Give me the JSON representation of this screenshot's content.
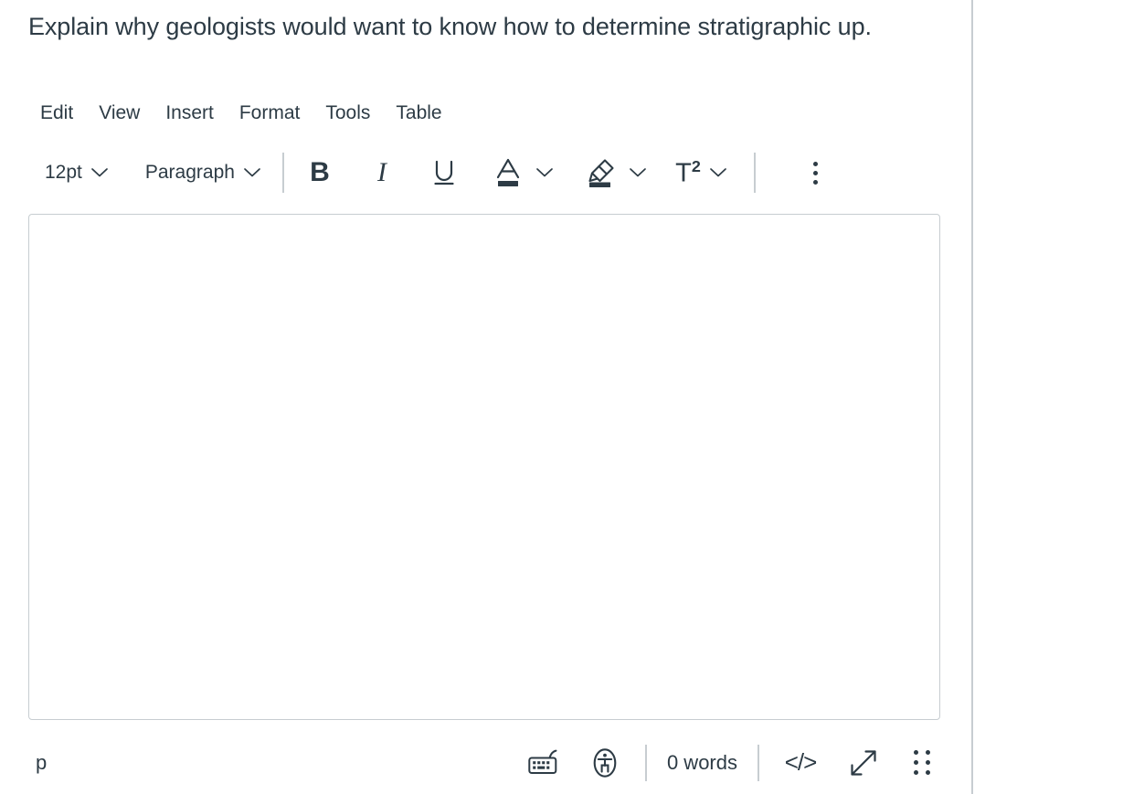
{
  "prompt": {
    "text": "Explain why geologists would want to know how to determine stratigraphic up."
  },
  "menubar": {
    "items": [
      {
        "label": "Edit",
        "name": "menu-edit"
      },
      {
        "label": "View",
        "name": "menu-view"
      },
      {
        "label": "Insert",
        "name": "menu-insert"
      },
      {
        "label": "Format",
        "name": "menu-format"
      },
      {
        "label": "Tools",
        "name": "menu-tools"
      },
      {
        "label": "Table",
        "name": "menu-table"
      }
    ]
  },
  "toolbar": {
    "font_size": "12pt",
    "block_format": "Paragraph",
    "bold_label": "B",
    "italic_label": "I",
    "underline_label": "U",
    "text_color_label": "A",
    "superscript_label": "T",
    "superscript_exponent": "2",
    "more_options_label": "More..."
  },
  "editor": {
    "content": "",
    "placeholder": ""
  },
  "statusbar": {
    "element_path": "p",
    "word_count": "0 words",
    "keyboard_shortcuts_label": "Keyboard shortcuts",
    "accessibility_checker_label": "Accessibility checker",
    "html_editor_label": "</>",
    "fullscreen_label": "Fullscreen",
    "resize_label": "Resize"
  },
  "colors": {
    "text": "#2D3B45",
    "border": "#C7CDD1",
    "background": "#FFFFFF"
  }
}
